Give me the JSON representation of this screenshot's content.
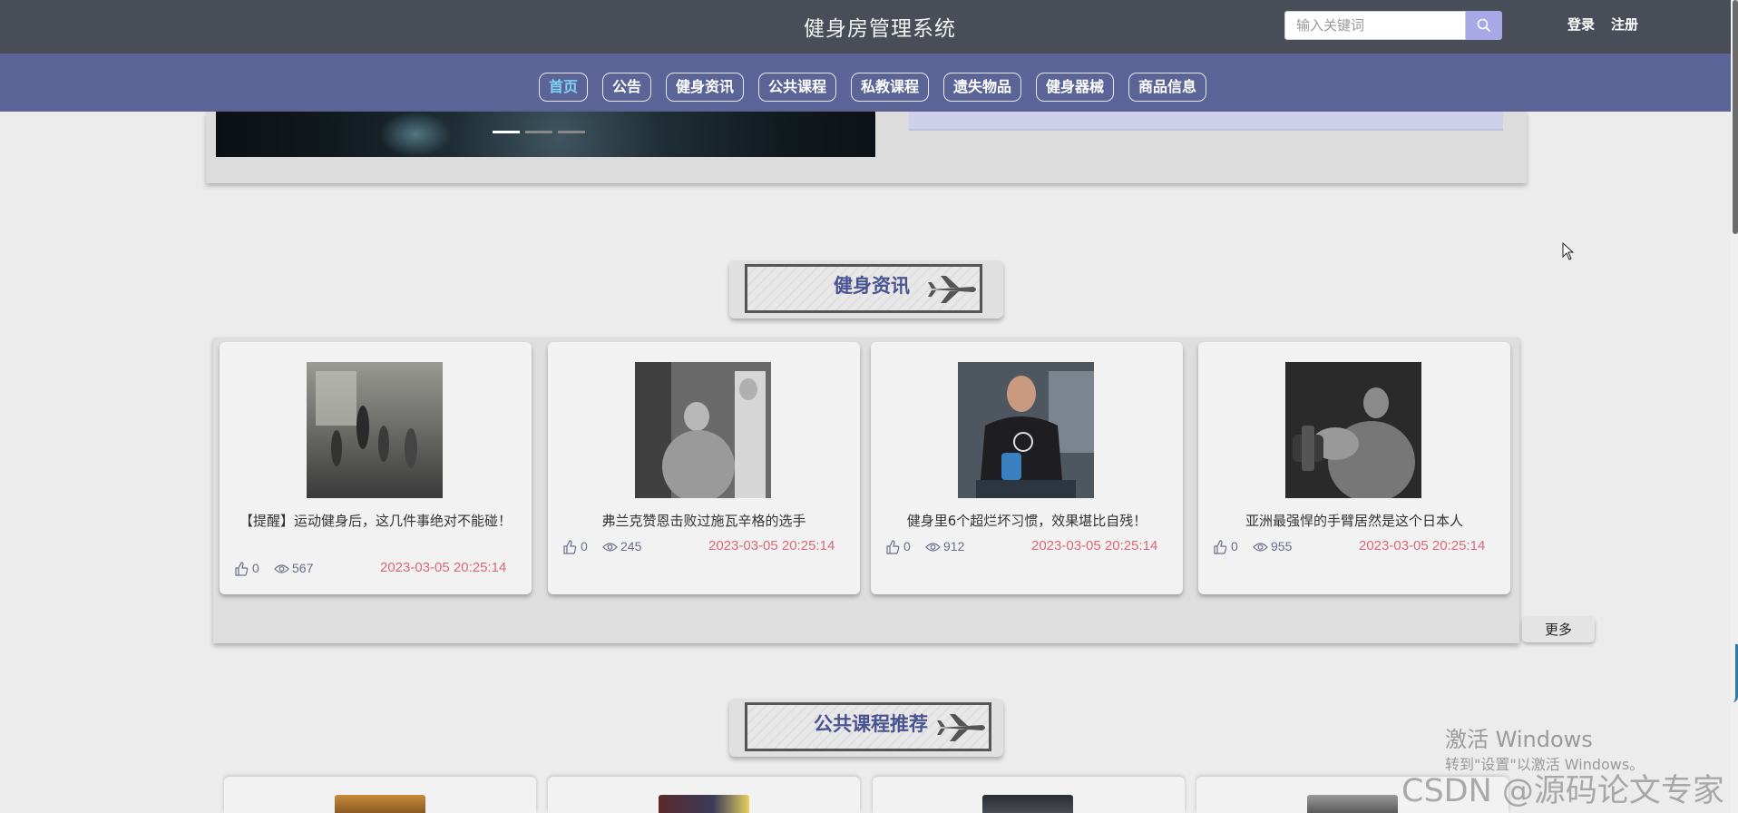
{
  "header": {
    "site_title": "健身房管理系统",
    "search_placeholder": "输入关键词",
    "login_label": "登录",
    "register_label": "注册"
  },
  "nav": {
    "items": [
      {
        "label": "首页",
        "active": true
      },
      {
        "label": "公告"
      },
      {
        "label": "健身资讯"
      },
      {
        "label": "公共课程"
      },
      {
        "label": "私教课程"
      },
      {
        "label": "遗失物品"
      },
      {
        "label": "健身器械"
      },
      {
        "label": "商品信息"
      }
    ]
  },
  "banner": {
    "indicators": 3,
    "active_index": 0
  },
  "news_section": {
    "title": "健身资讯",
    "more_label": "更多",
    "items": [
      {
        "title": "【提醒】运动健身后，这几件事绝对不能碰！",
        "likes": "0",
        "views": "567",
        "date": "2023-03-05 20:25:14"
      },
      {
        "title": "弗兰克赞恩击败过施瓦辛格的选手",
        "likes": "0",
        "views": "245",
        "date": "2023-03-05 20:25:14"
      },
      {
        "title": "健身里6个超烂坏习惯，效果堪比自残！",
        "likes": "0",
        "views": "912",
        "date": "2023-03-05 20:25:14"
      },
      {
        "title": "亚洲最强悍的手臂居然是这个日本人",
        "likes": "0",
        "views": "955",
        "date": "2023-03-05 20:25:14"
      }
    ]
  },
  "course_section": {
    "title": "公共课程推荐"
  },
  "watermarks": {
    "windows_title": "激活 Windows",
    "windows_sub": "转到\"设置\"以激活 Windows。",
    "csdn": "CSDN @源码论文专家"
  },
  "colors": {
    "topbar": "#484d58",
    "navbar": "#5b6496",
    "accent": "#4a5391",
    "date_red": "#d9687b"
  }
}
